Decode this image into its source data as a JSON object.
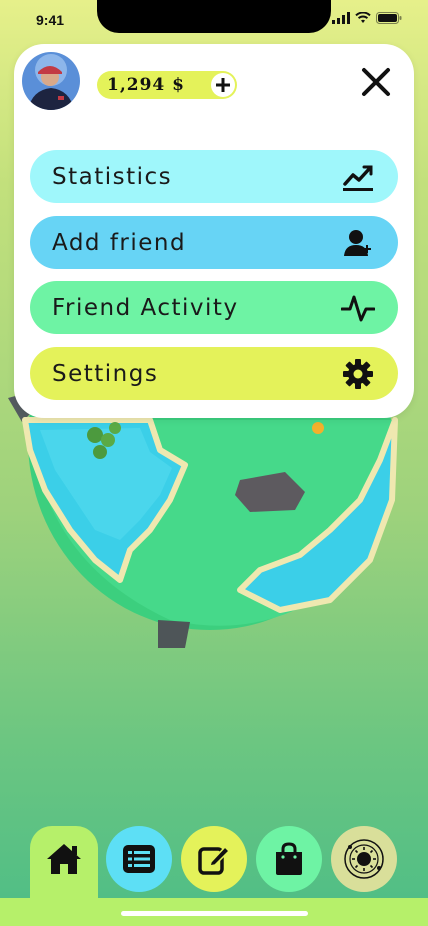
{
  "status_bar": {
    "time": "9:41"
  },
  "header": {
    "coins": "1,294 $",
    "avatar_icon": "user-avatar",
    "add_coins_icon": "plus-icon",
    "close_icon": "close-icon"
  },
  "menu": {
    "items": [
      {
        "label": "Statistics",
        "icon": "chart-trend-icon",
        "color": "#9ff7fb"
      },
      {
        "label": "Add friend",
        "icon": "add-user-icon",
        "color": "#67d4f5"
      },
      {
        "label": "Friend Activity",
        "icon": "activity-pulse-icon",
        "color": "#6ef3a4"
      },
      {
        "label": "Settings",
        "icon": "gear-icon",
        "color": "#e4f25a"
      }
    ]
  },
  "bottom_nav": {
    "items": [
      {
        "name": "home",
        "icon": "home-icon",
        "color": "#b6f06a",
        "active": true
      },
      {
        "name": "list",
        "icon": "list-icon",
        "color": "#5ddff5"
      },
      {
        "name": "edit",
        "icon": "edit-icon",
        "color": "#e4f25a"
      },
      {
        "name": "shop",
        "icon": "shopping-bag-icon",
        "color": "#6ef3a4"
      },
      {
        "name": "world",
        "icon": "sun-orbit-icon",
        "color": "#d9df9a"
      }
    ]
  }
}
